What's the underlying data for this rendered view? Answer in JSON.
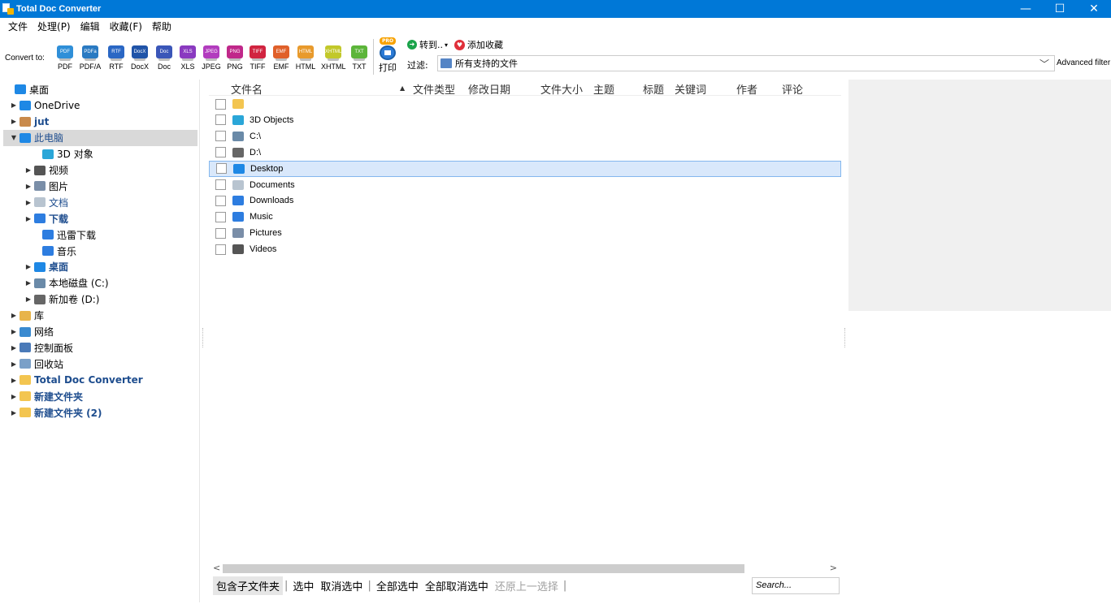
{
  "window": {
    "title": "Total Doc Converter"
  },
  "menu": [
    "文件",
    "处理(P)",
    "编辑",
    "收藏(F)",
    "帮助"
  ],
  "toolbar": {
    "convert_label": "Convert to:",
    "formats": [
      {
        "label": "PDF",
        "icon_text": "PDF",
        "color": "#2f8fd8"
      },
      {
        "label": "PDF/A",
        "icon_text": "PDFa",
        "color": "#2a7ac2"
      },
      {
        "label": "RTF",
        "icon_text": "RTF",
        "color": "#2a67c4"
      },
      {
        "label": "DocX",
        "icon_text": "DocX",
        "color": "#2054a8"
      },
      {
        "label": "Doc",
        "icon_text": "Doc",
        "color": "#3a56b8"
      },
      {
        "label": "XLS",
        "icon_text": "XLS",
        "color": "#8a3ac0"
      },
      {
        "label": "JPEG",
        "icon_text": "JPEG",
        "color": "#b23cbe"
      },
      {
        "label": "PNG",
        "icon_text": "PNG",
        "color": "#c0288a"
      },
      {
        "label": "TIFF",
        "icon_text": "TIFF",
        "color": "#d12440"
      },
      {
        "label": "EMF",
        "icon_text": "EMF",
        "color": "#e0602a"
      },
      {
        "label": "HTML",
        "icon_text": "HTML",
        "color": "#e89a2c"
      },
      {
        "label": "XHTML",
        "icon_text": "XHTML",
        "color": "#c2c82a"
      },
      {
        "label": "TXT",
        "icon_text": "TXT",
        "color": "#5cb53a"
      }
    ],
    "print_badge": "PRO",
    "print_label": "打印",
    "goto_label": "转到..",
    "goto_caret": "▾",
    "favorite_label": "添加收藏",
    "filter_label": "过滤:",
    "filter_value": "所有支持的文件",
    "advanced_filter": "Advanced filter"
  },
  "tree": [
    {
      "label": "桌面",
      "arrow": "",
      "icon": "desktop-icon",
      "color": "#1e88e5",
      "style": ""
    },
    {
      "label": "OneDrive",
      "arrow": "▶",
      "icon": "cloud-icon",
      "color": "#1e88e5",
      "style": ""
    },
    {
      "label": "jut",
      "arrow": "▶",
      "icon": "user-icon",
      "color": "#c98a4b",
      "style": "blue"
    },
    {
      "label": "此电脑",
      "arrow": "▼",
      "icon": "computer-icon",
      "color": "#1e88e5",
      "style": "bluen"
    },
    {
      "label": "3D 对象",
      "arrow": "",
      "icon": "cube-icon",
      "color": "#2aa6d8",
      "style": ""
    },
    {
      "label": "视频",
      "arrow": "▶",
      "icon": "video-icon",
      "color": "#555555",
      "style": ""
    },
    {
      "label": "图片",
      "arrow": "▶",
      "icon": "pictures-icon",
      "color": "#7a8ea8",
      "style": ""
    },
    {
      "label": "文档",
      "arrow": "▶",
      "icon": "document-icon",
      "color": "#b8c4d0",
      "style": "bluen"
    },
    {
      "label": "下载",
      "arrow": "▶",
      "icon": "download-icon",
      "color": "#2d7de0",
      "style": "blue"
    },
    {
      "label": "迅雷下载",
      "arrow": "",
      "icon": "thunder-icon",
      "color": "#2d7de0",
      "style": ""
    },
    {
      "label": "音乐",
      "arrow": "",
      "icon": "music-icon",
      "color": "#2d7de0",
      "style": ""
    },
    {
      "label": "桌面",
      "arrow": "▶",
      "icon": "desktop-icon",
      "color": "#1e88e5",
      "style": "blue"
    },
    {
      "label": "本地磁盘 (C:)",
      "arrow": "▶",
      "icon": "drive-c-icon",
      "color": "#6a8aa8",
      "style": ""
    },
    {
      "label": "新加卷 (D:)",
      "arrow": "▶",
      "icon": "drive-icon",
      "color": "#666666",
      "style": ""
    },
    {
      "label": "库",
      "arrow": "▶",
      "icon": "library-icon",
      "color": "#e8b44a",
      "style": ""
    },
    {
      "label": "网络",
      "arrow": "▶",
      "icon": "network-icon",
      "color": "#3a8ad0",
      "style": ""
    },
    {
      "label": "控制面板",
      "arrow": "▶",
      "icon": "control-panel-icon",
      "color": "#4a7ab8",
      "style": ""
    },
    {
      "label": "回收站",
      "arrow": "▶",
      "icon": "recycle-bin-icon",
      "color": "#7aa0c8",
      "style": ""
    },
    {
      "label": "Total Doc Converter",
      "arrow": "▶",
      "icon": "folder-icon",
      "color": "#f3c550",
      "style": "blue"
    },
    {
      "label": "新建文件夹",
      "arrow": "▶",
      "icon": "folder-icon",
      "color": "#f3c550",
      "style": "blue"
    },
    {
      "label": "新建文件夹 (2)",
      "arrow": "▶",
      "icon": "folder-icon",
      "color": "#f3c550",
      "style": "blue"
    }
  ],
  "columns": [
    "文件名",
    "文件类型",
    "修改日期",
    "文件大小",
    "主题",
    "标题",
    "关键词",
    "作者",
    "评论"
  ],
  "sort_indicator": "▲",
  "files": [
    {
      "name": "",
      "icon": "folder-icon",
      "color": "#f3c550"
    },
    {
      "name": "3D Objects",
      "icon": "cube-icon",
      "color": "#2aa6d8"
    },
    {
      "name": "C:\\",
      "icon": "drive-c-icon",
      "color": "#6a8aa8"
    },
    {
      "name": "D:\\",
      "icon": "drive-icon",
      "color": "#666666"
    },
    {
      "name": "Desktop",
      "icon": "desktop-icon",
      "color": "#1e88e5"
    },
    {
      "name": "Documents",
      "icon": "document-icon",
      "color": "#b8c4d0"
    },
    {
      "name": "Downloads",
      "icon": "download-icon",
      "color": "#2d7de0"
    },
    {
      "name": "Music",
      "icon": "music-icon",
      "color": "#2d7de0"
    },
    {
      "name": "Pictures",
      "icon": "pictures-icon",
      "color": "#7a8ea8"
    },
    {
      "name": "Videos",
      "icon": "video-icon",
      "color": "#555555"
    }
  ],
  "bottom": {
    "include_subfolders": "包含子文件夹",
    "select": "选中",
    "deselect": "取消选中",
    "select_all": "全部选中",
    "deselect_all": "全部取消选中",
    "undo_selection": "还原上一选择",
    "search_placeholder": "Search..."
  },
  "scroll": {
    "left_arrow": "<",
    "right_arrow": ">"
  },
  "window_controls": {
    "minimize": "—",
    "maximize": "☐",
    "close": "✕"
  }
}
